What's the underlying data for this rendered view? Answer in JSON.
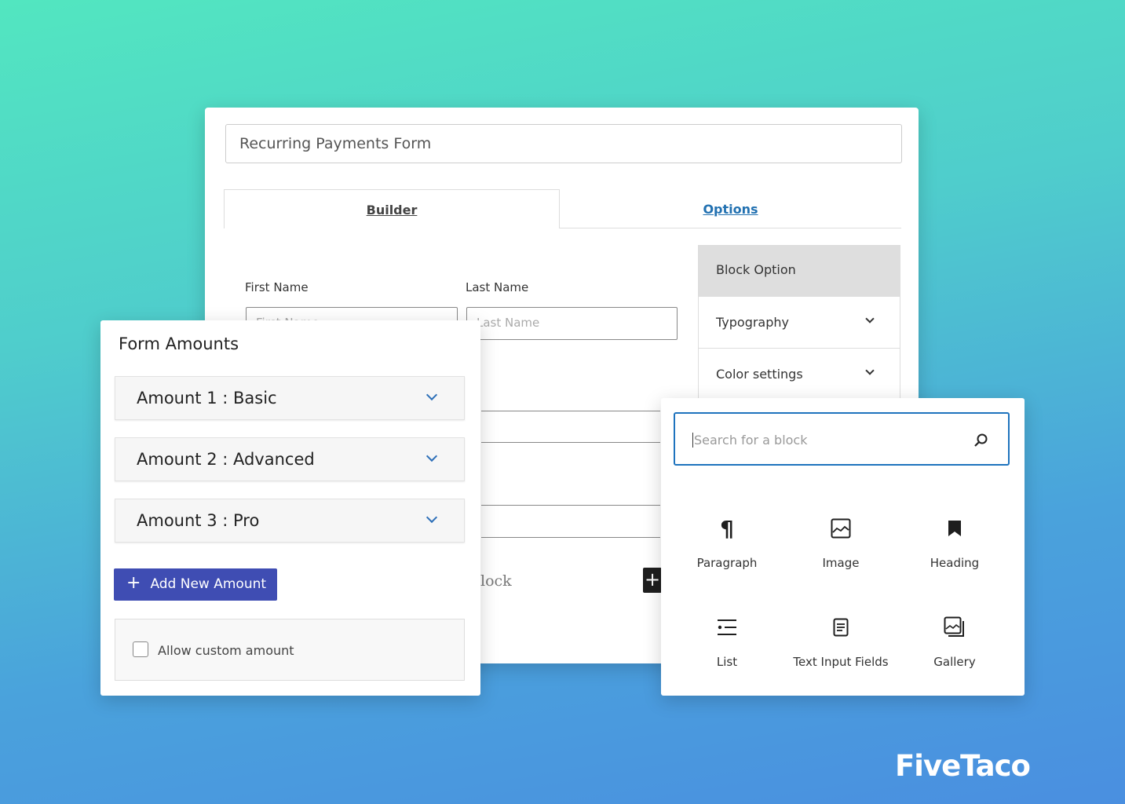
{
  "form_title": "Recurring Payments Form",
  "tabs": [
    {
      "label": "Builder",
      "active": true
    },
    {
      "label": "Options",
      "active": false
    }
  ],
  "fields": {
    "first_name_label": "First Name",
    "first_name_placeholder": "First Name",
    "last_name_label": "Last Name",
    "last_name_placeholder": "Last Name"
  },
  "partial_block_text": "lock",
  "block_option": {
    "header": "Block Option",
    "items": [
      {
        "label": "Typography",
        "icon": "chevron-down-icon"
      },
      {
        "label": "Color settings",
        "icon": "chevron-down-icon"
      }
    ]
  },
  "form_amounts": {
    "title": "Form Amounts",
    "amounts": [
      {
        "label": "Amount 1 : Basic"
      },
      {
        "label": "Amount 2 : Advanced"
      },
      {
        "label": "Amount 3 : Pro"
      }
    ],
    "add_button": "Add New Amount",
    "custom_amount_label": "Allow custom amount",
    "custom_amount_checked": false
  },
  "inserter": {
    "search_placeholder": "Search for a block",
    "blocks": [
      {
        "label": "Paragraph",
        "icon": "paragraph-icon"
      },
      {
        "label": "Image",
        "icon": "image-icon"
      },
      {
        "label": "Heading",
        "icon": "bookmark-icon"
      },
      {
        "label": "List",
        "icon": "list-icon"
      },
      {
        "label": "Text Input Fields",
        "icon": "document-icon"
      },
      {
        "label": "Gallery",
        "icon": "gallery-icon"
      }
    ]
  },
  "brand": "FiveTaco",
  "colors": {
    "accent": "#3f4db3",
    "link": "#2271b1",
    "search_border": "#1e73be"
  }
}
